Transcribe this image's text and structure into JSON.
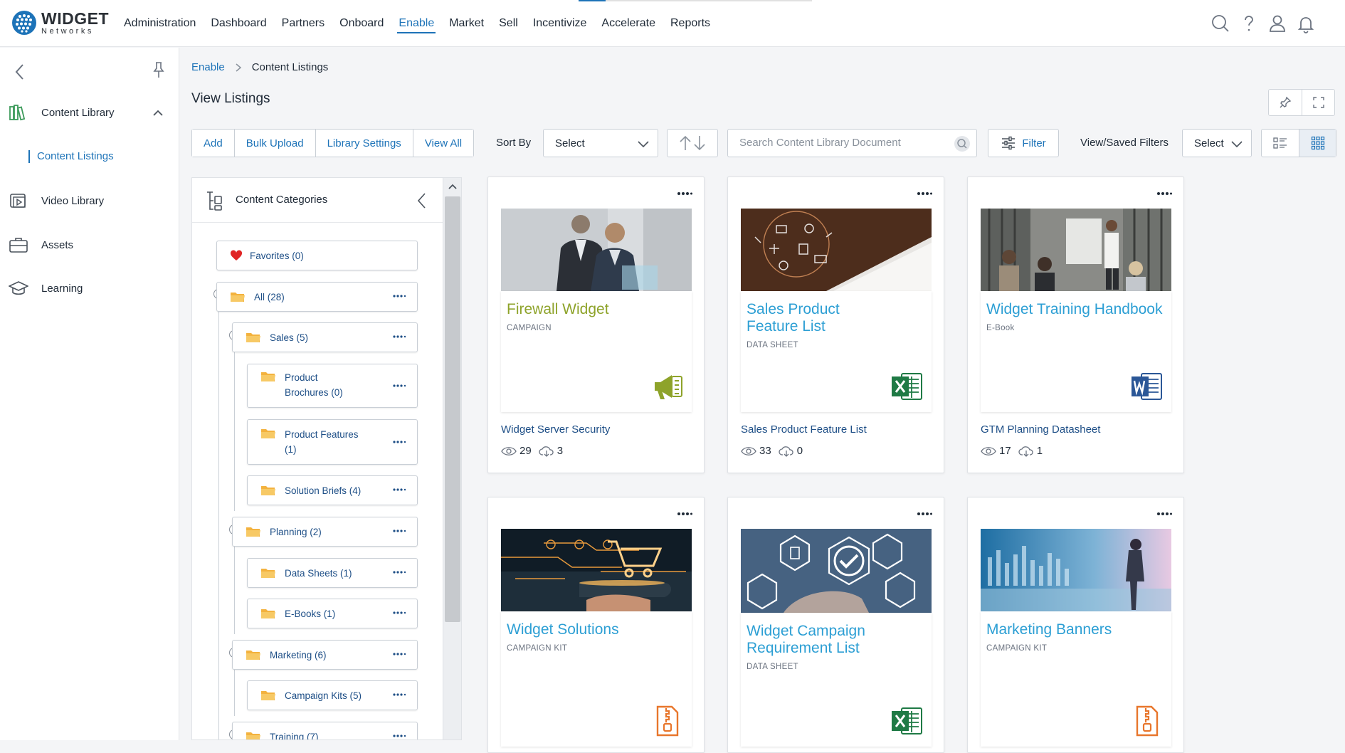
{
  "brand": {
    "name": "WIDGET",
    "sub": "Networks"
  },
  "nav": {
    "items": [
      {
        "label": "Administration"
      },
      {
        "label": "Dashboard"
      },
      {
        "label": "Partners"
      },
      {
        "label": "Onboard"
      },
      {
        "label": "Enable",
        "active": true
      },
      {
        "label": "Market"
      },
      {
        "label": "Sell"
      },
      {
        "label": "Incentivize"
      },
      {
        "label": "Accelerate"
      },
      {
        "label": "Reports"
      }
    ],
    "icons": [
      "search-icon",
      "help-icon",
      "user-icon",
      "bell-icon"
    ]
  },
  "sidebar": {
    "items": [
      {
        "label": "Content Library",
        "icon": "books-icon",
        "expanded": true
      },
      {
        "label": "Video Library",
        "icon": "video-icon"
      },
      {
        "label": "Assets",
        "icon": "briefcase-icon"
      },
      {
        "label": "Learning",
        "icon": "graduation-cap-icon"
      }
    ],
    "sub": {
      "label": "Content Listings"
    }
  },
  "breadcrumb": {
    "parent": "Enable",
    "current": "Content Listings"
  },
  "page": {
    "title": "View Listings"
  },
  "toolbar": {
    "buttons": [
      "Add",
      "Bulk Upload",
      "Library Settings",
      "View All"
    ],
    "sort_label": "Sort By",
    "sort_value": "Select",
    "search_placeholder": "Search Content Library Document",
    "filter_label": "Filter",
    "saved_filters_label": "View/Saved Filters",
    "saved_filters_value": "Select",
    "view_mode": "grid"
  },
  "categories": {
    "title": "Content Categories",
    "favorites": "Favorites (0)",
    "nodes": [
      {
        "label": "All (28)"
      },
      {
        "label": "Sales (5)"
      },
      {
        "label": "Product Brochures (0)"
      },
      {
        "label": "Product Features (1)"
      },
      {
        "label": "Solution Briefs (4)"
      },
      {
        "label": "Planning (2)"
      },
      {
        "label": "Data Sheets (1)"
      },
      {
        "label": "E-Books (1)"
      },
      {
        "label": "Marketing (6)"
      },
      {
        "label": "Campaign Kits (5)"
      },
      {
        "label": "Training (7)"
      }
    ]
  },
  "cards": [
    {
      "title": "Firewall Widget",
      "type": "CAMPAIGN",
      "name": "Widget Server Security",
      "views": "29",
      "downloads": "3",
      "file_icon": "megaphone-icon",
      "title_color": "#8ea32a"
    },
    {
      "title": "Sales Product Feature List",
      "type": "DATA SHEET",
      "name": "Sales Product Feature List",
      "views": "33",
      "downloads": "0",
      "file_icon": "excel-icon",
      "title_color": "#2d9fd4"
    },
    {
      "title": "Widget Training Handbook",
      "type": "E-Book",
      "name": "GTM Planning Datasheet",
      "views": "17",
      "downloads": "1",
      "file_icon": "word-icon",
      "title_color": "#2d9fd4"
    },
    {
      "title": "Widget Solutions",
      "type": "CAMPAIGN KIT",
      "file_icon": "zip-icon",
      "title_color": "#2d9fd4"
    },
    {
      "title": "Widget Campaign Requirement List",
      "type": "DATA SHEET",
      "file_icon": "excel-icon",
      "title_color": "#2d9fd4"
    },
    {
      "title": "Marketing Banners",
      "type": "CAMPAIGN KIT",
      "file_icon": "zip-icon",
      "title_color": "#2d9fd4"
    }
  ],
  "colors": {
    "accent": "#1d73b8",
    "card_title": "#2d9fd4",
    "campaign_green": "#8ea32a",
    "excel": "#1f7a45",
    "word": "#2b5797",
    "zip": "#e8762c",
    "heart": "#e02424",
    "folder": "#f3b23e"
  }
}
